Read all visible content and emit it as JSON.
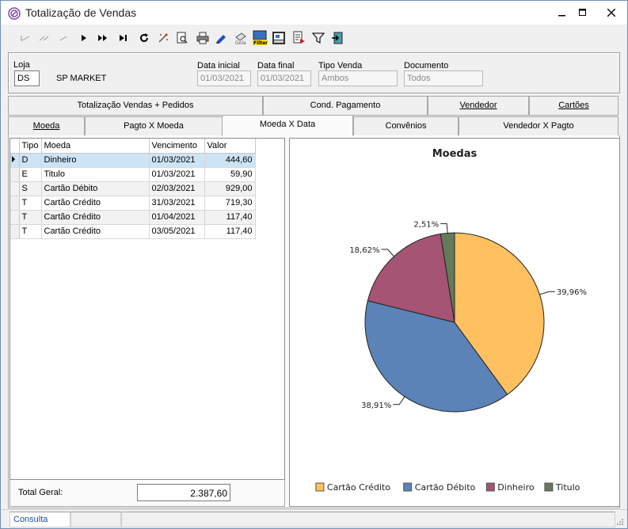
{
  "window": {
    "title": "Totalização de Vendas"
  },
  "header": {
    "loja_label": "Loja",
    "loja_code": "DS",
    "loja_name": "SP MARKET",
    "data_inicial_label": "Data inicial",
    "data_inicial": "01/03/2021",
    "data_final_label": "Data final",
    "data_final": "01/03/2021",
    "tipo_venda_label": "Tipo Venda",
    "tipo_venda": "Ambos",
    "documento_label": "Documento",
    "documento": "Todos"
  },
  "tabs_row1": [
    "Totalização Vendas + Pedidos",
    "Cond. Pagamento",
    "Vendedor",
    "Cartões"
  ],
  "tabs_row2": [
    "Moeda",
    "Pagto X Moeda",
    "Moeda X Data",
    "Convênios",
    "Vendedor X Pagto"
  ],
  "selected_tab": "Moeda X Data",
  "grid": {
    "columns": [
      "Tipo",
      "Moeda",
      "Vencimento",
      "Valor"
    ],
    "rows": [
      {
        "tipo": "D",
        "moeda": "Dinheiro",
        "vencimento": "01/03/2021",
        "valor": "444,60"
      },
      {
        "tipo": "E",
        "moeda": "Titulo",
        "vencimento": "01/03/2021",
        "valor": "59,90"
      },
      {
        "tipo": "S",
        "moeda": "Cartão Débito",
        "vencimento": "02/03/2021",
        "valor": "929,00"
      },
      {
        "tipo": "T",
        "moeda": "Cartão Crédito",
        "vencimento": "31/03/2021",
        "valor": "719,30"
      },
      {
        "tipo": "T",
        "moeda": "Cartão Crédito",
        "vencimento": "01/04/2021",
        "valor": "117,40"
      },
      {
        "tipo": "T",
        "moeda": "Cartão Crédito",
        "vencimento": "03/05/2021",
        "valor": "117,40"
      }
    ]
  },
  "total": {
    "label": "Total Geral:",
    "value": "2.387,60"
  },
  "chart_data": {
    "type": "pie",
    "title": "Moedas",
    "legend_position": "bottom",
    "slices": [
      {
        "name": "Cartão Crédito",
        "value": 39.96,
        "label": "39,96%",
        "color": "#FFC060"
      },
      {
        "name": "Cartão Débito",
        "value": 38.91,
        "label": "38,91%",
        "color": "#5B83B7"
      },
      {
        "name": "Dinheiro",
        "value": 18.62,
        "label": "18,62%",
        "color": "#A55473"
      },
      {
        "name": "Titulo",
        "value": 2.51,
        "label": "2,51%",
        "color": "#65795C"
      }
    ]
  },
  "status": {
    "mode": "Consulta"
  },
  "toolbar_icons": [
    "first-icon",
    "prev-page-icon",
    "prev-icon",
    "next-icon",
    "next-page-icon",
    "last-icon",
    "refresh-icon",
    "magic-icon",
    "preview-icon",
    "print-icon",
    "edit-icon",
    "clear-icon",
    "filter-icon",
    "report-icon",
    "export-icon",
    "funnel-icon",
    "exit-icon"
  ]
}
